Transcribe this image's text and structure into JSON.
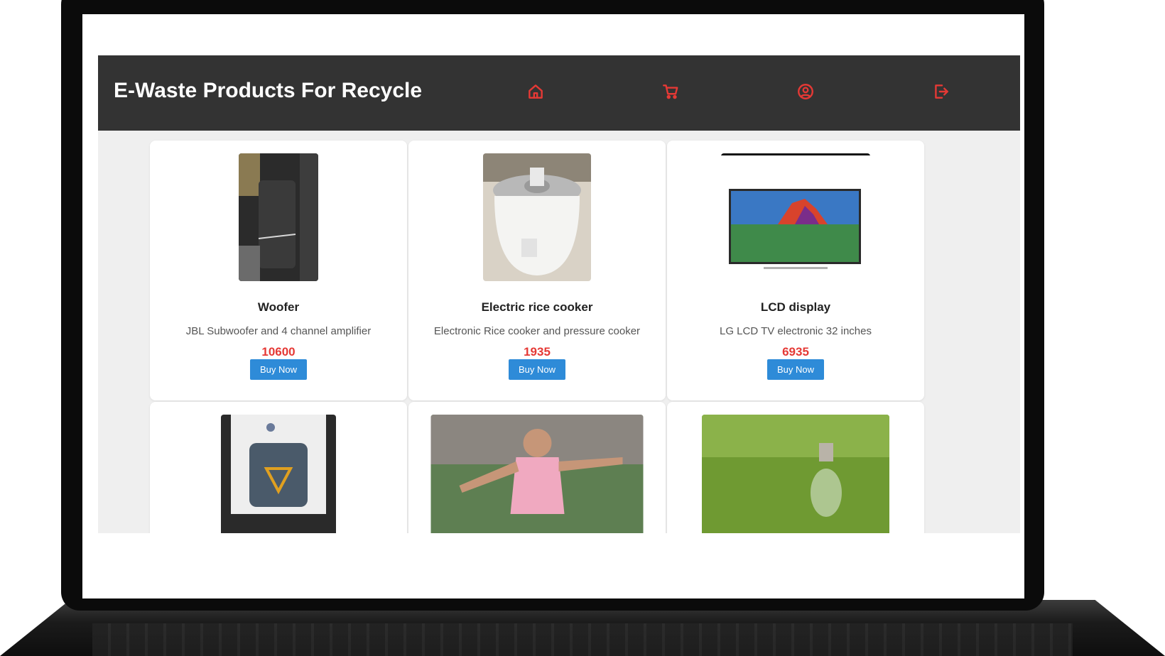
{
  "header": {
    "title": "E-Waste Products For Recycle",
    "nav_icons": [
      "home-icon",
      "cart-icon",
      "user-circle-icon",
      "logout-icon"
    ],
    "icon_color": "#e53935",
    "background": "#333333"
  },
  "products": [
    {
      "name": "Woofer",
      "description": "JBL Subwoofer and 4 channel amplifier",
      "price": "10600",
      "button": "Buy Now"
    },
    {
      "name": "Electric rice cooker",
      "description": "Electronic Rice cooker and pressure cooker",
      "price": "1935",
      "button": "Buy Now"
    },
    {
      "name": "LCD display",
      "description": "LG LCD TV electronic 32 inches",
      "price": "6935",
      "button": "Buy Now"
    },
    {
      "name": "",
      "description": "",
      "price": "",
      "button": ""
    },
    {
      "name": "",
      "description": "",
      "price": "",
      "button": ""
    },
    {
      "name": "",
      "description": "",
      "price": "",
      "button": ""
    }
  ],
  "colors": {
    "price": "#e53935",
    "button": "#2e8bd8",
    "page_background": "#efefef"
  }
}
